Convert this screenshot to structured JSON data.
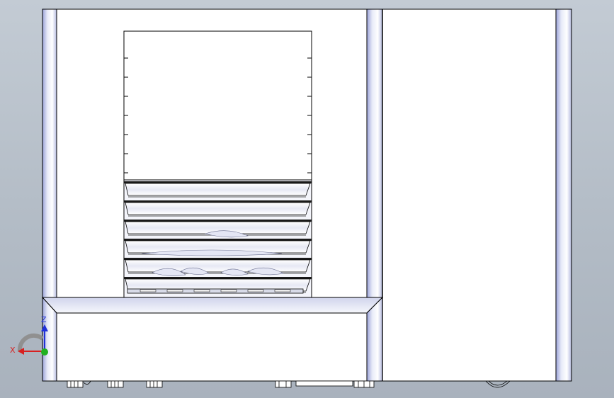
{
  "viewport": {
    "background_top": "#c3cbd4",
    "background_bottom": "#a9b2bd"
  },
  "model": {
    "edge_color": "#000000",
    "face_color": "#ffffff",
    "post_shade": "#c8cde8",
    "fin_count": 6
  },
  "triad": {
    "x_label": "X",
    "z_label": "Z",
    "x_color": "#d82020",
    "y_color": "#20b020",
    "z_color": "#2030d8"
  }
}
